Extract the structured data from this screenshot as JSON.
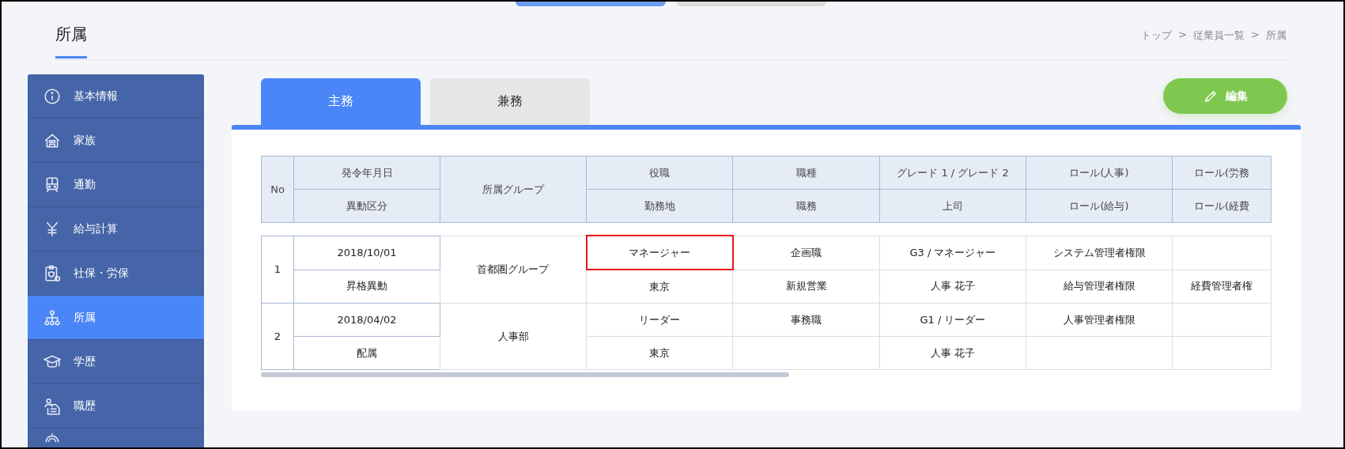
{
  "top_tabs": [
    {
      "selected": true
    },
    {
      "selected": false
    }
  ],
  "page_title": "所属",
  "breadcrumb": [
    {
      "kind": "link",
      "text": "トップ"
    },
    {
      "kind": "sep",
      "text": ">"
    },
    {
      "kind": "link",
      "text": "従業員一覧"
    },
    {
      "kind": "sep",
      "text": ">"
    },
    {
      "kind": "current",
      "text": "所属"
    }
  ],
  "sidebar": {
    "items": [
      {
        "label": "基本情報",
        "selected": false
      },
      {
        "label": "家族",
        "selected": false
      },
      {
        "label": "通勤",
        "selected": false
      },
      {
        "label": "給与計算",
        "selected": false
      },
      {
        "label": "社保・労保",
        "selected": false
      },
      {
        "label": "所属",
        "selected": true
      },
      {
        "label": "学歴",
        "selected": false
      },
      {
        "label": "職歴",
        "selected": false
      }
    ]
  },
  "tabs": [
    {
      "label": "主務",
      "selected": true
    },
    {
      "label": "兼務",
      "selected": false
    }
  ],
  "edit_button": {
    "label": "編集"
  },
  "table": {
    "columns": [
      {
        "kind": "merged",
        "text": "No"
      },
      {
        "kind": "split",
        "top": "発令年月日",
        "bottom": "異動区分"
      },
      {
        "kind": "merged",
        "text": "所属グループ"
      },
      {
        "kind": "split",
        "top": "役職",
        "bottom": "勤務地"
      },
      {
        "kind": "split",
        "top": "職種",
        "bottom": "職務"
      },
      {
        "kind": "split",
        "top": "グレード 1 / グレード 2",
        "bottom": "上司"
      },
      {
        "kind": "split",
        "top": "ロール(人事)",
        "bottom": "ロール(給与)"
      },
      {
        "kind": "split",
        "top": "ロール(労務",
        "bottom": "ロール(経費"
      }
    ],
    "rows": [
      {
        "cells": [
          {
            "kind": "merged",
            "text": "1"
          },
          {
            "kind": "split",
            "top": "2018/10/01",
            "bottom": "昇格異動",
            "top_highlighted": false
          },
          {
            "kind": "merged",
            "text": "首都圏グループ"
          },
          {
            "kind": "split",
            "top": "マネージャー",
            "bottom": "東京",
            "top_highlighted": true
          },
          {
            "kind": "split",
            "top": "企画職",
            "bottom": "新規営業",
            "top_highlighted": false
          },
          {
            "kind": "split",
            "top": "G3 / マネージャー",
            "bottom": "人事 花子",
            "top_highlighted": false
          },
          {
            "kind": "split",
            "top": "システム管理者権限",
            "bottom": "給与管理者権限",
            "top_highlighted": false
          },
          {
            "kind": "split",
            "bottom": "経費管理者権",
            "top_highlighted": false
          }
        ]
      },
      {
        "cells": [
          {
            "kind": "merged",
            "text": "2"
          },
          {
            "kind": "split",
            "top": "2018/04/02",
            "bottom": "配属",
            "top_highlighted": false
          },
          {
            "kind": "merged",
            "text": "人事部"
          },
          {
            "kind": "split",
            "top": "リーダー",
            "bottom": "東京",
            "top_highlighted": false
          },
          {
            "kind": "split",
            "top": "事務職",
            "top_highlighted": false
          },
          {
            "kind": "split",
            "top": "G1 / リーダー",
            "bottom": "人事 花子",
            "top_highlighted": false
          },
          {
            "kind": "split",
            "top": "人事管理者権限",
            "top_highlighted": false
          },
          {
            "kind": "split",
            "top_highlighted": false
          }
        ]
      }
    ]
  }
}
